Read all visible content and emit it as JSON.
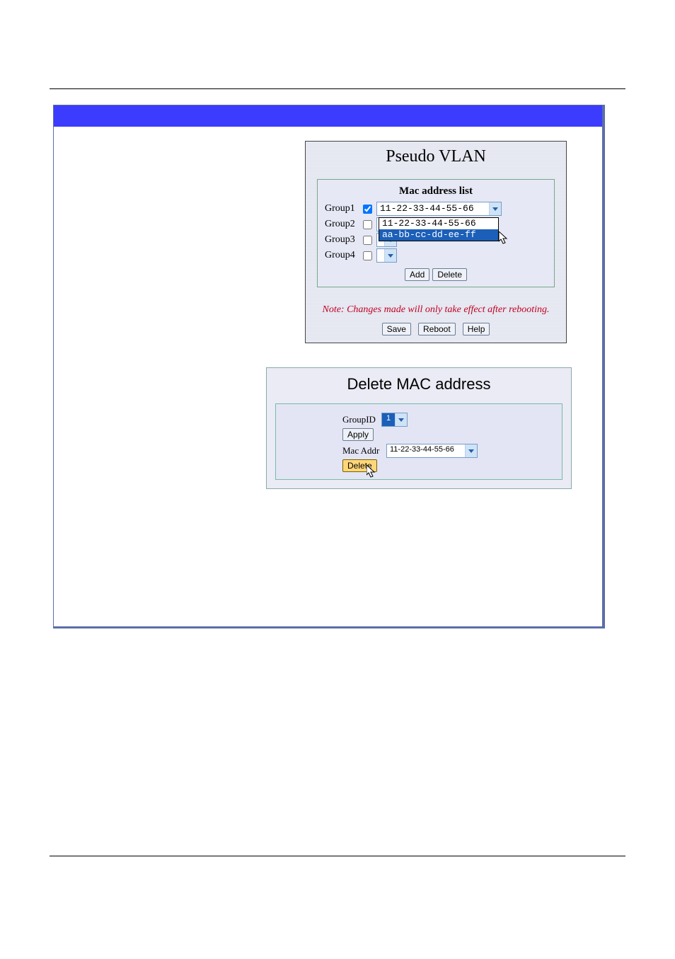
{
  "panel1": {
    "title": "Pseudo VLAN",
    "list_title": "Mac address list",
    "groups": [
      {
        "label": "Group1",
        "checked": true,
        "selected": "11-22-33-44-55-66",
        "wide": true
      },
      {
        "label": "Group2",
        "checked": false,
        "selected": "",
        "wide": false
      },
      {
        "label": "Group3",
        "checked": false,
        "selected": "",
        "wide": false
      },
      {
        "label": "Group4",
        "checked": false,
        "selected": "",
        "wide": false
      }
    ],
    "dropdown_open_items": [
      {
        "text": "11-22-33-44-55-66",
        "hi": false
      },
      {
        "text": "aa-bb-cc-dd-ee-ff",
        "hi": true
      }
    ],
    "add_label": "Add",
    "delete_label": "Delete",
    "note": "Note: Changes made will only take effect after rebooting.",
    "save_label": "Save",
    "reboot_label": "Reboot",
    "help_label": "Help"
  },
  "panel2": {
    "title": "Delete MAC address",
    "groupid_label": "GroupID",
    "groupid_value": "1",
    "apply_label": "Apply",
    "mac_label": "Mac Addr",
    "mac_value": "11-22-33-44-55-66",
    "delete_label": "Delete"
  }
}
